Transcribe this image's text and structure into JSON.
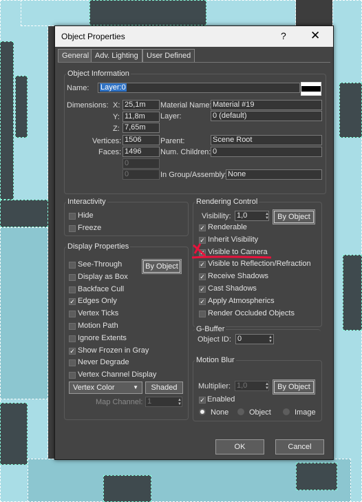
{
  "window": {
    "title": "Object Properties",
    "help": "?",
    "close": "✕"
  },
  "tabs": [
    {
      "label": "General",
      "active": true
    },
    {
      "label": "Adv. Lighting",
      "active": false
    },
    {
      "label": "User Defined",
      "active": false
    }
  ],
  "object_info": {
    "title": "Object Information",
    "name_label": "Name:",
    "name_value": "Layer:0",
    "color_swatch": "#000000",
    "dimensions_label": "Dimensions:",
    "x_label": "X:",
    "x_value": "25,1m",
    "y_label": "Y:",
    "y_value": "11,8m",
    "z_label": "Z:",
    "z_value": "7,65m",
    "material_name_label": "Material Name:",
    "material_name_value": "Material #19",
    "layer_label": "Layer:",
    "layer_value": "0 (default)",
    "vertices_label": "Vertices:",
    "vertices_value": "1506",
    "faces_label": "Faces:",
    "faces_value": "1496",
    "extra1_value": "0",
    "extra2_value": "0",
    "parent_label": "Parent:",
    "parent_value": "Scene Root",
    "num_children_label": "Num. Children:",
    "num_children_value": "0",
    "group_label": "In Group/Assembly:",
    "group_value": "None"
  },
  "interactivity": {
    "title": "Interactivity",
    "items": [
      {
        "label": "Hide",
        "checked": false
      },
      {
        "label": "Freeze",
        "checked": false
      }
    ]
  },
  "display_properties": {
    "title": "Display Properties",
    "by_object": "By Object",
    "items": [
      {
        "label": "See-Through",
        "checked": false
      },
      {
        "label": "Display as Box",
        "checked": false
      },
      {
        "label": "Backface Cull",
        "checked": false
      },
      {
        "label": "Edges Only",
        "checked": true
      },
      {
        "label": "Vertex Ticks",
        "checked": false
      },
      {
        "label": "Motion Path",
        "checked": false
      },
      {
        "label": "Ignore Extents",
        "checked": false
      },
      {
        "label": "Show Frozen in Gray",
        "checked": true
      },
      {
        "label": "Never Degrade",
        "checked": false
      },
      {
        "label": "Vertex Channel Display",
        "checked": false
      }
    ],
    "vertex_color": "Vertex Color",
    "shaded": "Shaded",
    "map_channel_label": "Map Channel:",
    "map_channel_value": "1"
  },
  "rendering_control": {
    "title": "Rendering Control",
    "visibility_label": "Visibility:",
    "visibility_value": "1,0",
    "by_object": "By Object",
    "items": [
      {
        "label": "Renderable",
        "checked": true
      },
      {
        "label": "Inherit Visibility",
        "checked": true
      },
      {
        "label": "Visible to Camera",
        "checked": true
      },
      {
        "label": "Visible to Reflection/Refraction",
        "checked": true
      },
      {
        "label": "Receive Shadows",
        "checked": true
      },
      {
        "label": "Cast Shadows",
        "checked": true
      },
      {
        "label": "Apply Atmospherics",
        "checked": true
      },
      {
        "label": "Render Occluded Objects",
        "checked": false
      }
    ]
  },
  "gbuffer": {
    "title": "G-Buffer",
    "object_id_label": "Object ID:",
    "object_id_value": "0"
  },
  "motion_blur": {
    "title": "Motion Blur",
    "multiplier_label": "Multiplier:",
    "multiplier_value": "1,0",
    "by_object": "By Object",
    "enabled_label": "Enabled",
    "enabled_checked": true,
    "options": [
      {
        "label": "None",
        "selected": true
      },
      {
        "label": "Object",
        "selected": false
      },
      {
        "label": "Image",
        "selected": false
      }
    ]
  },
  "footer": {
    "ok": "OK",
    "cancel": "Cancel"
  },
  "colors": {
    "annotation": "#e8123c",
    "viewport_object": "#a9dde6"
  }
}
